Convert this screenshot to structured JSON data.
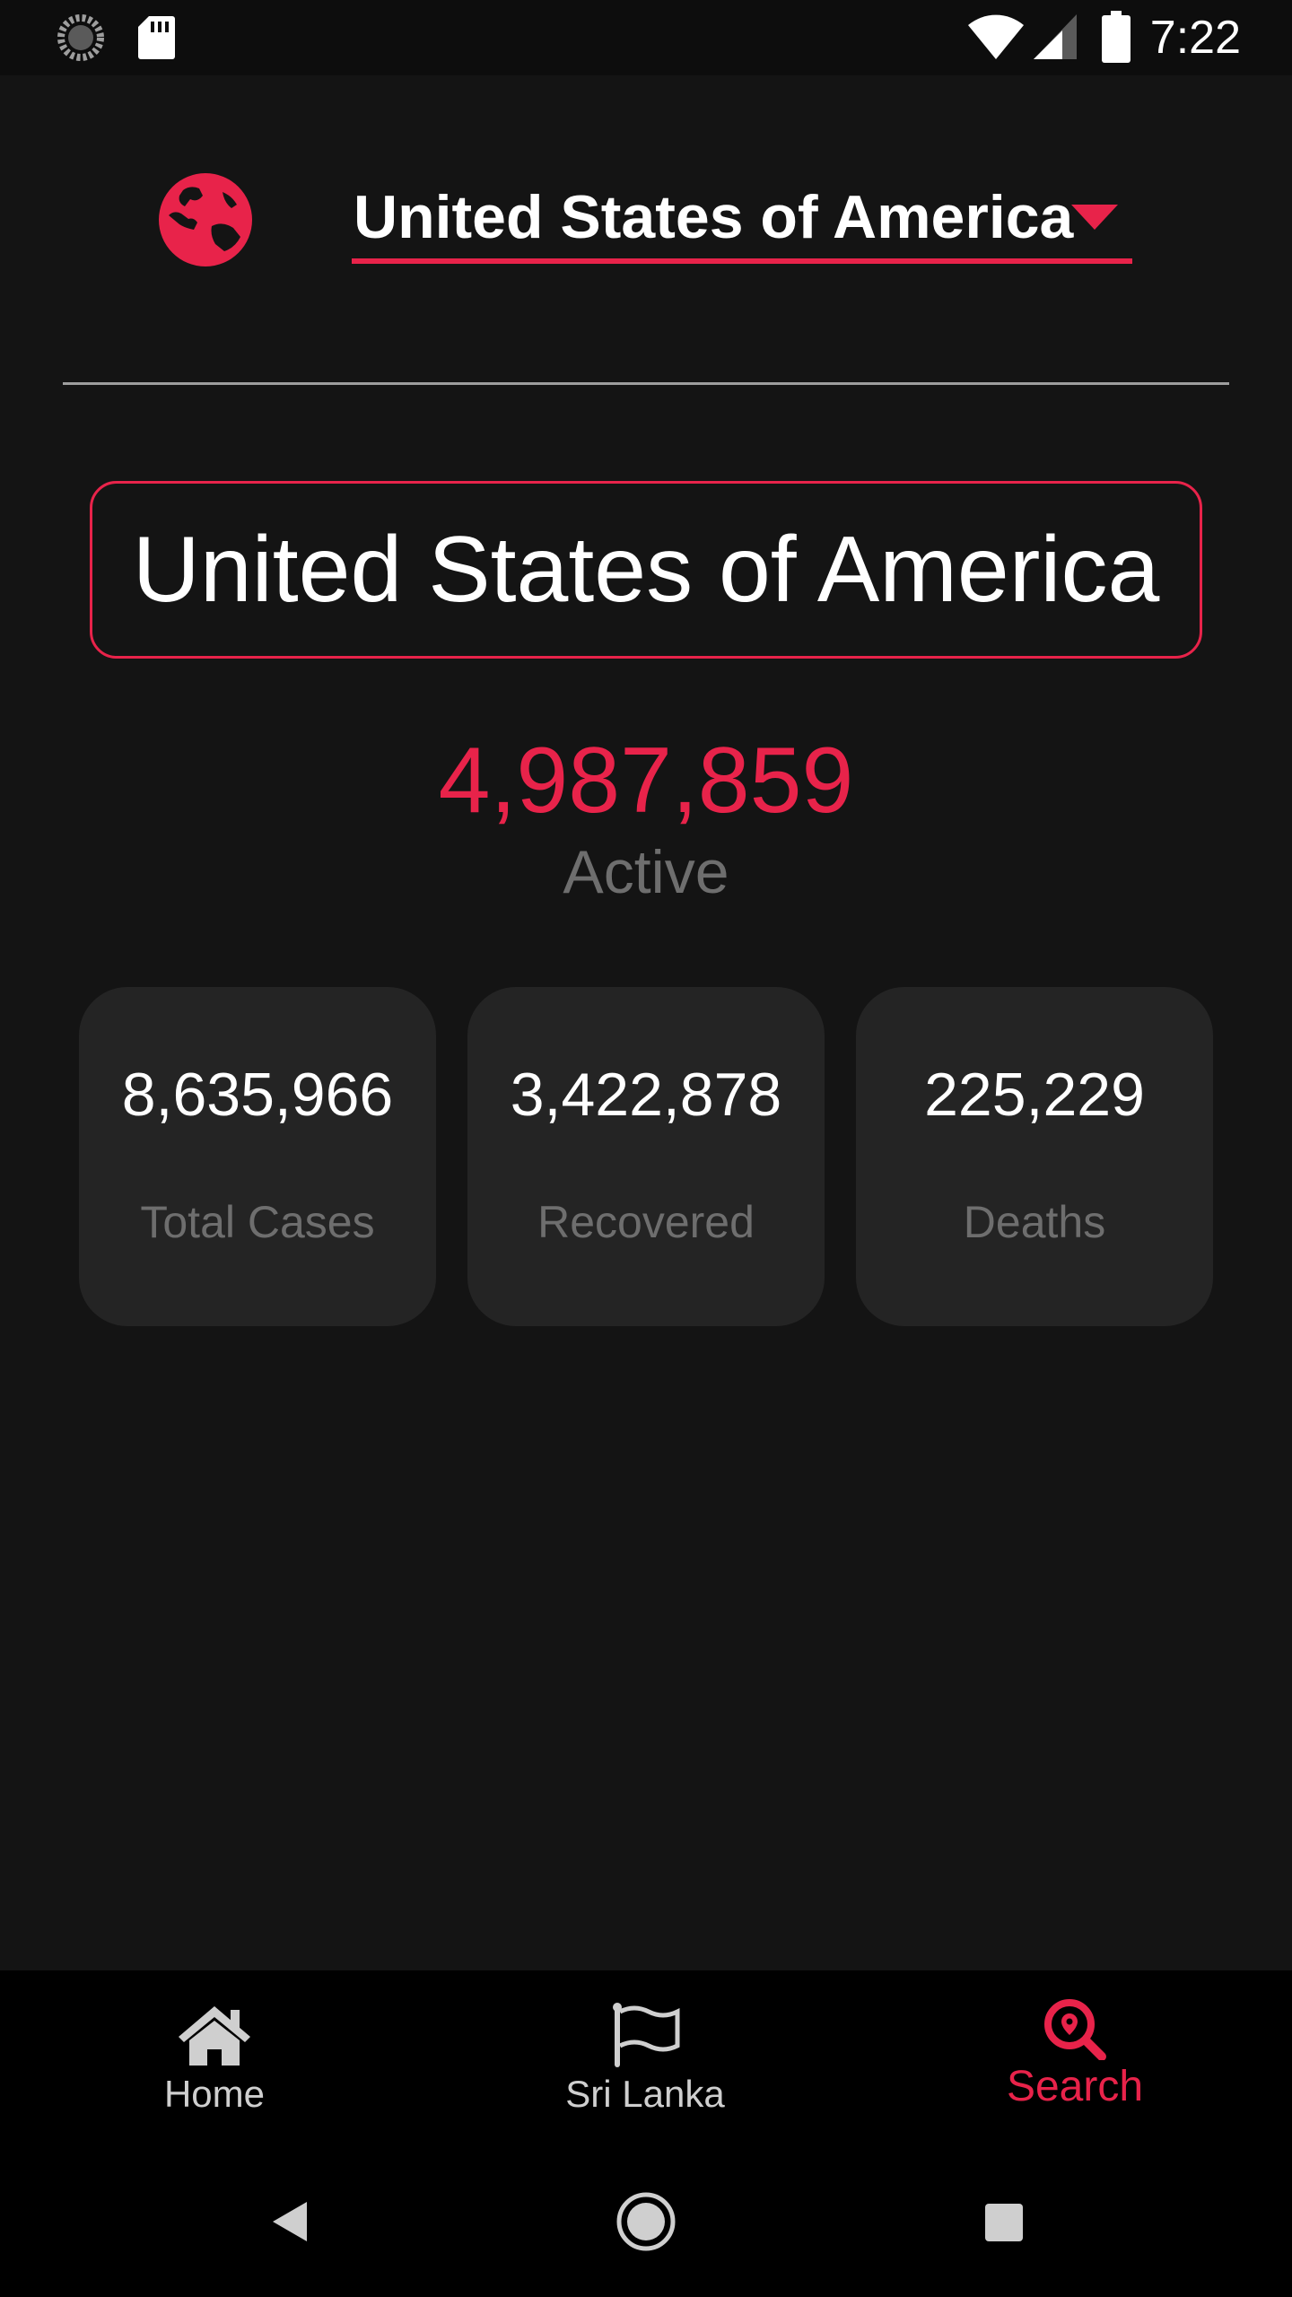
{
  "status_bar": {
    "time": "7:22",
    "icons": [
      "sync-icon",
      "sd-card-icon",
      "wifi-icon",
      "cellular-icon",
      "battery-icon"
    ]
  },
  "selector": {
    "icon": "globe-icon",
    "selected_country": "United States of America",
    "caret_icon": "caret-down-icon"
  },
  "country": {
    "name": "United States of America"
  },
  "active": {
    "value": "4,987,859",
    "label": "Active"
  },
  "stats": [
    {
      "value": "8,635,966",
      "label": "Total Cases"
    },
    {
      "value": "3,422,878",
      "label": "Recovered"
    },
    {
      "value": "225,229",
      "label": "Deaths"
    }
  ],
  "bottom_nav": {
    "items": [
      {
        "label": "Home",
        "icon": "home-icon"
      },
      {
        "label": "Sri Lanka",
        "icon": "flag-icon"
      },
      {
        "label": "Search",
        "icon": "search-location-icon",
        "active": true
      }
    ]
  },
  "system_nav": [
    "back-icon",
    "home-circle-icon",
    "recents-icon"
  ],
  "colors": {
    "accent": "#e8234a",
    "background": "#141414",
    "card": "#242424",
    "muted_text": "#6e6e6e"
  }
}
